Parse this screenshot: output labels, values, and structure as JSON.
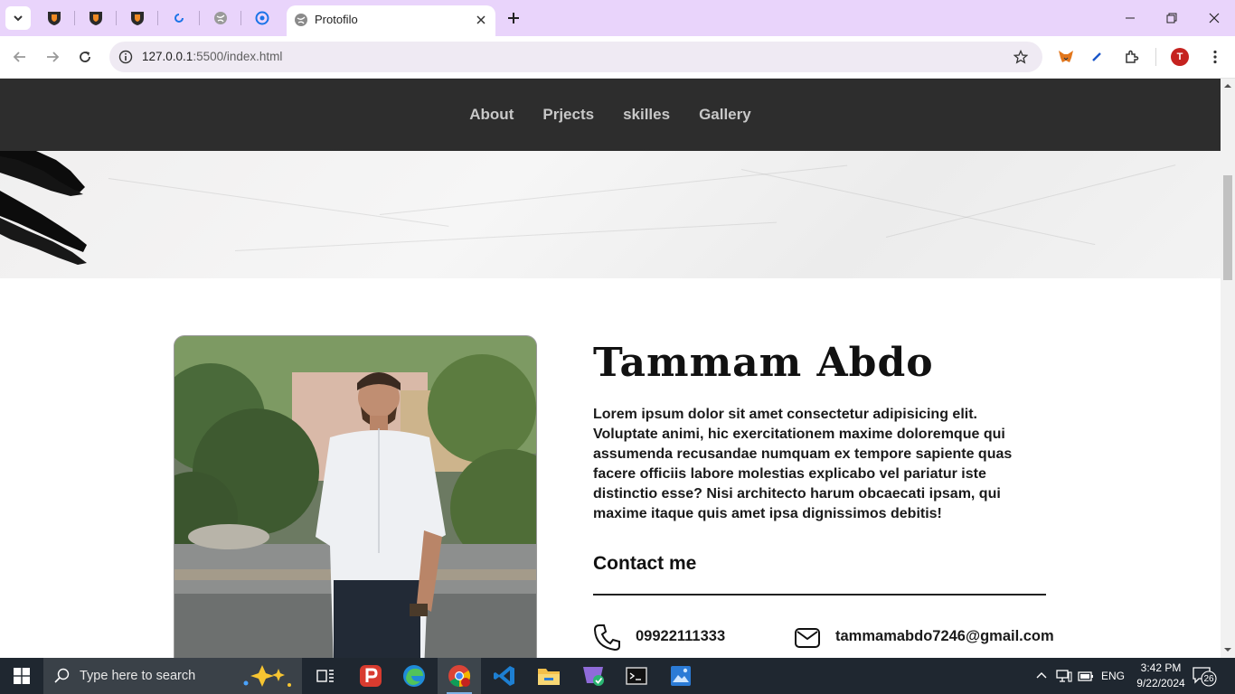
{
  "browser": {
    "active_tab_title": "Protofilo",
    "url_host": "127.0.0.1",
    "url_path": ":5500/index.html",
    "profile_initial": "T"
  },
  "site": {
    "nav": [
      {
        "label": "About"
      },
      {
        "label": "Prjects"
      },
      {
        "label": "skilles"
      },
      {
        "label": "Gallery"
      }
    ],
    "name": "Tammam Abdo",
    "bio": "Lorem ipsum dolor sit amet consectetur adipisicing elit. Voluptate animi, hic exercitationem maxime doloremque qui assumenda recusandae numquam ex tempore sapiente quas facere officiis labore molestias explicabo vel pariatur iste distinctio esse? Nisi architecto harum obcaecati ipsam, qui maxime itaque quis amet ipsa dignissimos debitis!",
    "contact_title": "Contact me",
    "phone": "09922111333",
    "email": "tammamabdo7246@gmail.com"
  },
  "taskbar": {
    "search_placeholder": "Type here to search",
    "language": "ENG",
    "time": "3:42 PM",
    "date": "9/22/2024",
    "notification_count": "26"
  },
  "colors": {
    "tabstrip": "#e9d4fb",
    "site_nav_bg": "#2d2d2d",
    "nav_text": "#c8c8c8",
    "taskbar_bg": "#1f2730"
  }
}
